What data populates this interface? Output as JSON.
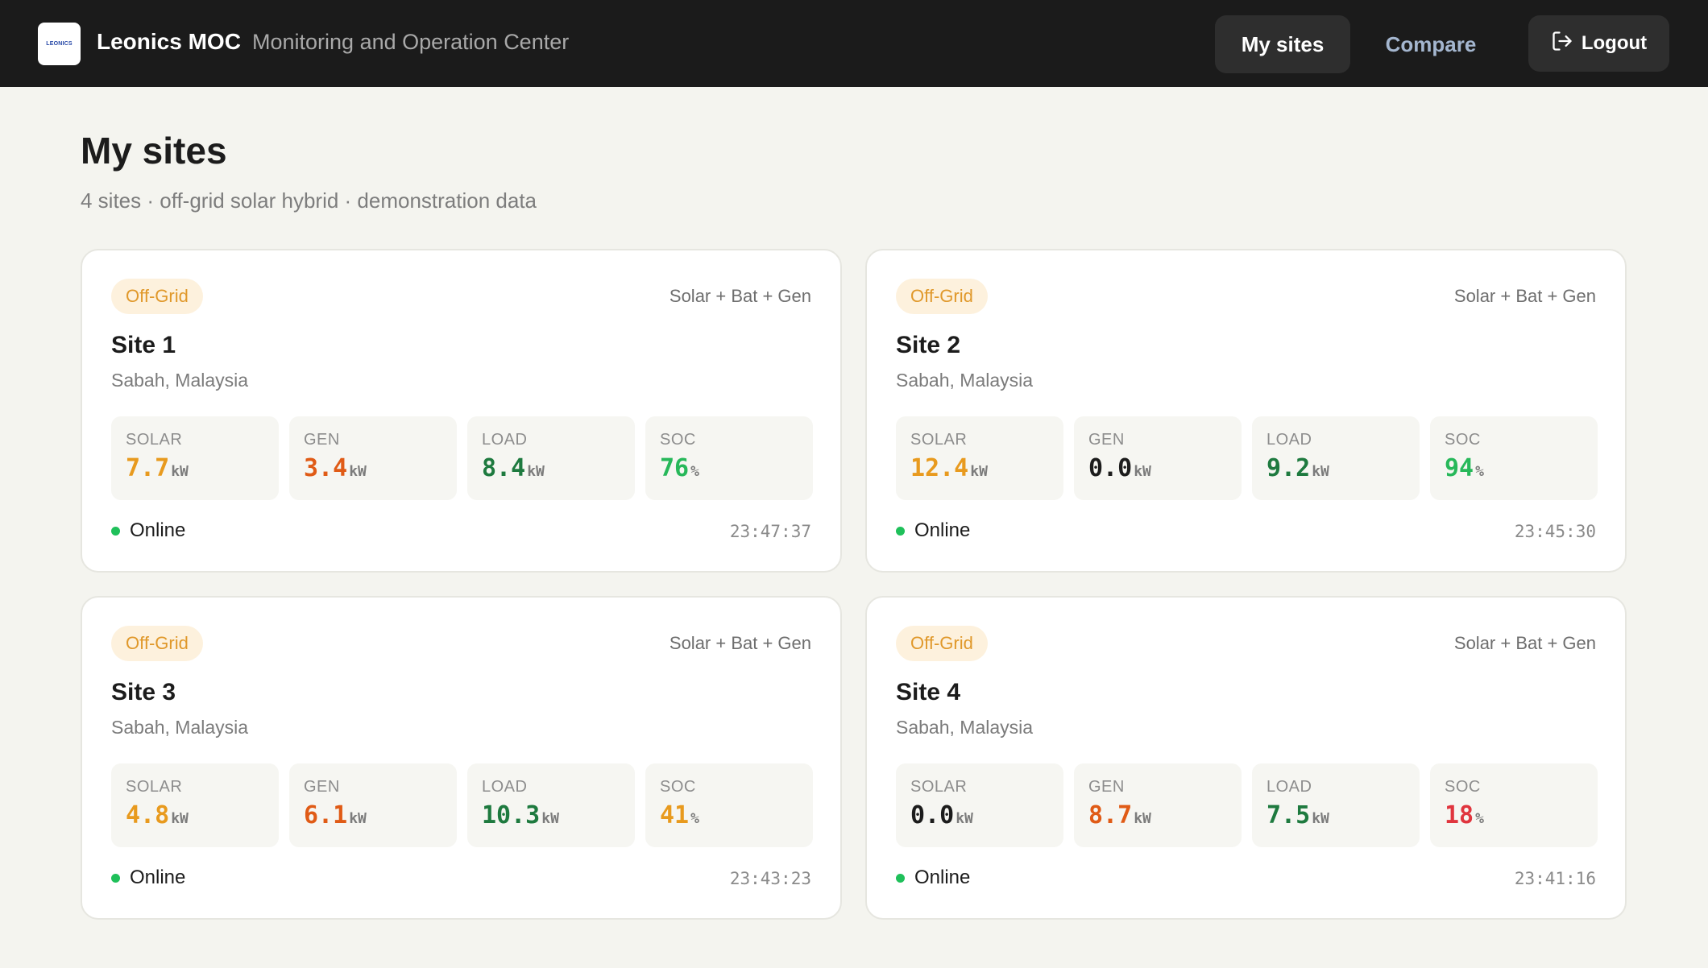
{
  "header": {
    "logo_text": "LEONICS",
    "brand": "Leonics MOC",
    "subtitle": "Monitoring and Operation Center",
    "nav": {
      "my_sites": "My sites",
      "compare": "Compare",
      "logout": "Logout"
    },
    "icons": {
      "logout": "logout-icon"
    }
  },
  "page": {
    "title": "My sites",
    "subtitle": "4 sites · off-grid solar hybrid · demonstration data"
  },
  "colors": {
    "solar": "#e89a1e",
    "gen_active": "#e05b16",
    "gen_idle": "#1c1c1c",
    "load": "#1e7a3f",
    "soc_high": "#27b85a",
    "soc_mid": "#e89a1e",
    "soc_low": "#e0353e",
    "online": "#1fc05a"
  },
  "labels": {
    "solar": "SOLAR",
    "gen": "GEN",
    "load": "LOAD",
    "soc": "SOC",
    "unit_kw": "kW",
    "unit_pct": "%"
  },
  "sites": [
    {
      "tag": "Off-Grid",
      "system": "Solar + Bat + Gen",
      "name": "Site 1",
      "location": "Sabah, Malaysia",
      "solar": "7.7",
      "gen": "3.4",
      "load": "8.4",
      "soc": "76",
      "status": "Online",
      "time": "23:47:37"
    },
    {
      "tag": "Off-Grid",
      "system": "Solar + Bat + Gen",
      "name": "Site 2",
      "location": "Sabah, Malaysia",
      "solar": "12.4",
      "gen": "0.0",
      "load": "9.2",
      "soc": "94",
      "status": "Online",
      "time": "23:45:30"
    },
    {
      "tag": "Off-Grid",
      "system": "Solar + Bat + Gen",
      "name": "Site 3",
      "location": "Sabah, Malaysia",
      "solar": "4.8",
      "gen": "6.1",
      "load": "10.3",
      "soc": "41",
      "status": "Online",
      "time": "23:43:23"
    },
    {
      "tag": "Off-Grid",
      "system": "Solar + Bat + Gen",
      "name": "Site 4",
      "location": "Sabah, Malaysia",
      "solar": "0.0",
      "gen": "8.7",
      "load": "7.5",
      "soc": "18",
      "status": "Online",
      "time": "23:41:16"
    }
  ]
}
